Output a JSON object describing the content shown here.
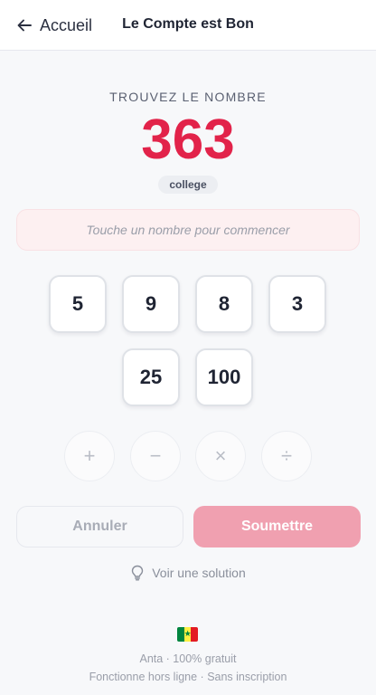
{
  "header": {
    "back_label": "Accueil",
    "title": "Le Compte est Bon"
  },
  "game": {
    "target_label": "TROUVEZ LE NOMBRE",
    "target": "363",
    "level": "college",
    "expression_placeholder": "Touche un nombre pour commencer",
    "numbers": [
      "5",
      "9",
      "8",
      "3",
      "25",
      "100"
    ],
    "operators": [
      "+",
      "−",
      "×",
      "÷"
    ]
  },
  "actions": {
    "cancel_label": "Annuler",
    "submit_label": "Soumettre",
    "solution_label": "Voir une solution"
  },
  "footer": {
    "line1": "Anta · 100% gratuit",
    "line2": "Fonctionne hors ligne · Sans inscription",
    "flag_star": "★"
  },
  "colors": {
    "accent": "#e2234a",
    "submit_disabled": "#f0a0b0",
    "expression_bg": "#fdf0f1"
  },
  "icons": {
    "back": "arrow-left-icon",
    "solution": "lightbulb-icon",
    "flag": "senegal-flag-icon"
  }
}
